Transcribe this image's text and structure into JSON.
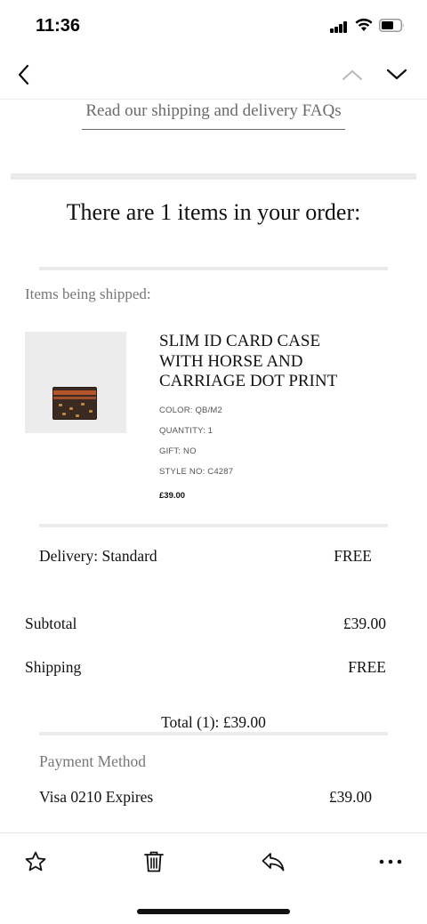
{
  "status_bar": {
    "time": "11:36"
  },
  "nav": {
    "back_icon": "chevron-left-icon",
    "prev_icon": "chevron-up-icon",
    "next_icon": "chevron-down-icon"
  },
  "faq_link": "Read our shipping and delivery FAQs",
  "order_heading": "There are 1 items in your order:",
  "items_label": "Items being shipped:",
  "item": {
    "name_lines": [
      "SLIM ID CARD CASE",
      "WITH HORSE AND",
      "CARRIAGE DOT PRINT"
    ],
    "color": "COLOR: QB/M2",
    "quantity": "QUANTITY: 1",
    "gift": "GIFT: NO",
    "style_no": "STYLE NO: C4287",
    "price": "£39.00"
  },
  "delivery": {
    "label": "Delivery: Standard",
    "value": "FREE"
  },
  "subtotal": {
    "label": "Subtotal",
    "value": "£39.00"
  },
  "shipping": {
    "label": "Shipping",
    "value": "FREE"
  },
  "total": "Total (1): £39.00",
  "payment": {
    "label": "Payment Method",
    "method": "Visa 0210 Expires",
    "amount": "£39.00"
  },
  "toolbar": {
    "icons": [
      "star-icon",
      "trash-icon",
      "reply-icon",
      "more-icon"
    ]
  },
  "colors": {
    "divider": "#ebebeb",
    "muted_text": "#777777",
    "text": "#111111"
  }
}
